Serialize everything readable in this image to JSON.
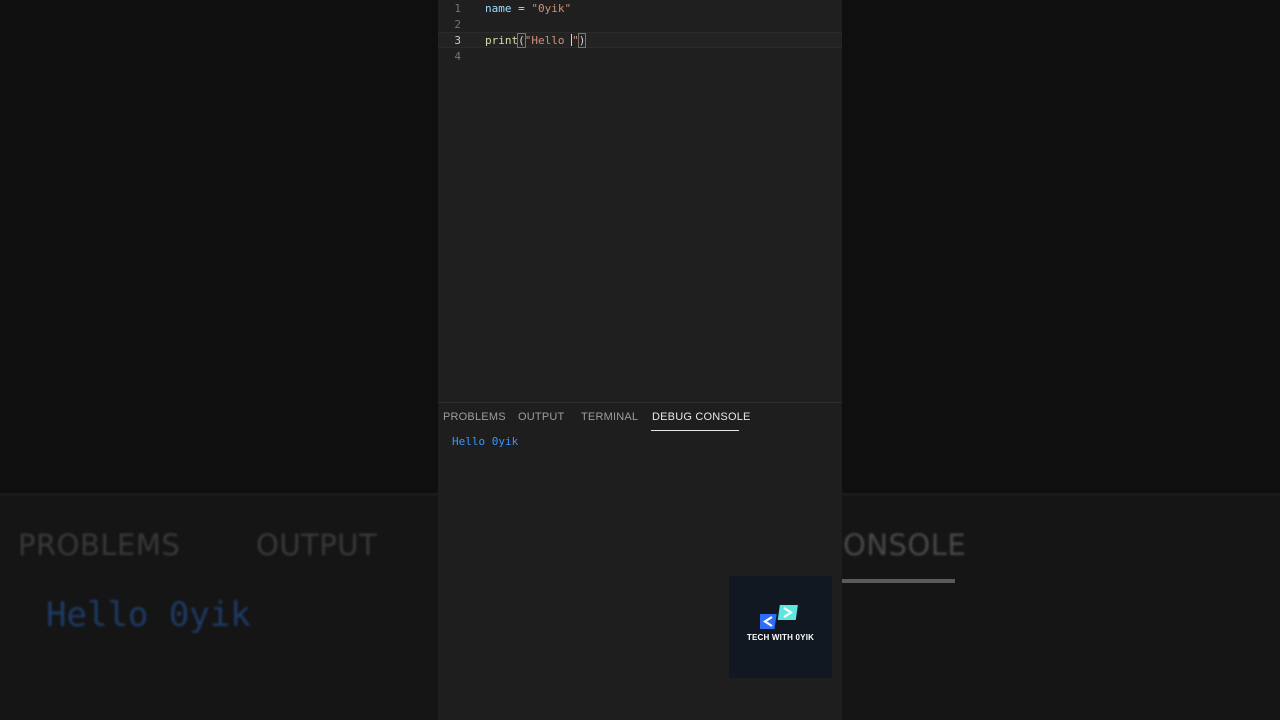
{
  "editor": {
    "lines": [
      {
        "number": "1",
        "tokens": {
          "var": "name",
          "op": " = ",
          "str": "\"0yik\""
        }
      },
      {
        "number": "2"
      },
      {
        "number": "3",
        "tokens": {
          "fn": "print",
          "open": "(",
          "str": "\"Hello ",
          "quote": "\"",
          "close": ")"
        }
      },
      {
        "number": "4"
      }
    ]
  },
  "panel": {
    "tabs": [
      "PROBLEMS",
      "OUTPUT",
      "TERMINAL",
      "DEBUG CONSOLE"
    ],
    "active_tab": "DEBUG CONSOLE",
    "console_output": "Hello 0yik"
  },
  "background": {
    "tab_problems": "PROBLEMS",
    "tab_output": "OUTPUT",
    "tab_console_partial": "ONSOLE",
    "output": "Hello 0yik"
  },
  "logo": {
    "text": "TECH WITH 0YIK",
    "icon": "code-brackets-icon"
  },
  "colors": {
    "accent_blue": "#3794ff",
    "logo_cyan": "#5ee6e0",
    "logo_blue": "#2f6df6"
  }
}
